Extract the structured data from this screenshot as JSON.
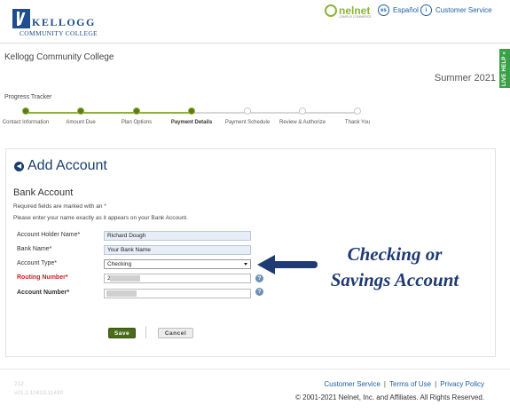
{
  "header": {
    "logo_name": "KELLOGG",
    "logo_sub": "COMMUNITY COLLEGE",
    "nelnet_name": "nelnet",
    "nelnet_tagline": "CAMPUS COMMERCE",
    "espanol_icon": "es",
    "espanol_label": "Español",
    "customer_service_label": "Customer Service"
  },
  "school_name": "Kellogg Community College",
  "term": "Summer 2021",
  "live_help": "LIVE HELP «",
  "progress": {
    "label": "Progress Tracker",
    "steps": [
      {
        "label": "Contact Information",
        "state": "done"
      },
      {
        "label": "Amount Due",
        "state": "done"
      },
      {
        "label": "Plan Options",
        "state": "done"
      },
      {
        "label": "Payment Details",
        "state": "current"
      },
      {
        "label": "Payment Schedule",
        "state": "todo"
      },
      {
        "label": "Review & Authorize",
        "state": "todo"
      },
      {
        "label": "Thank You",
        "state": "todo"
      }
    ]
  },
  "form": {
    "title": "Add Account",
    "section_title": "Bank Account",
    "required_note": "Required fields are marked with an *",
    "name_note": "Please enter your name exactly as it appears on your Bank Account.",
    "fields": {
      "holder": {
        "label": "Account Holder Name*",
        "value": "Richard Dough"
      },
      "bank": {
        "label": "Bank Name*",
        "value": "Your Bank Name"
      },
      "type": {
        "label": "Account Type*",
        "value": "Checking"
      },
      "routing": {
        "label": "Routing Number*",
        "value": "2"
      },
      "account": {
        "label": "Account Number*",
        "value": ""
      }
    },
    "help_glyph": "?",
    "save_label": "Save",
    "cancel_label": "Cancel"
  },
  "annotation": {
    "line1": "Checking or",
    "line2": "Savings Account",
    "color": "#1f3b73"
  },
  "footer": {
    "version_line1": "212",
    "version_line2": "v21.2.10413.11430",
    "links": [
      "Customer Service",
      "Terms of Use",
      "Privacy Policy"
    ],
    "separator": "|",
    "copyright": "© 2001-2021 Nelnet, Inc. and Affiliates. All Rights Reserved."
  }
}
